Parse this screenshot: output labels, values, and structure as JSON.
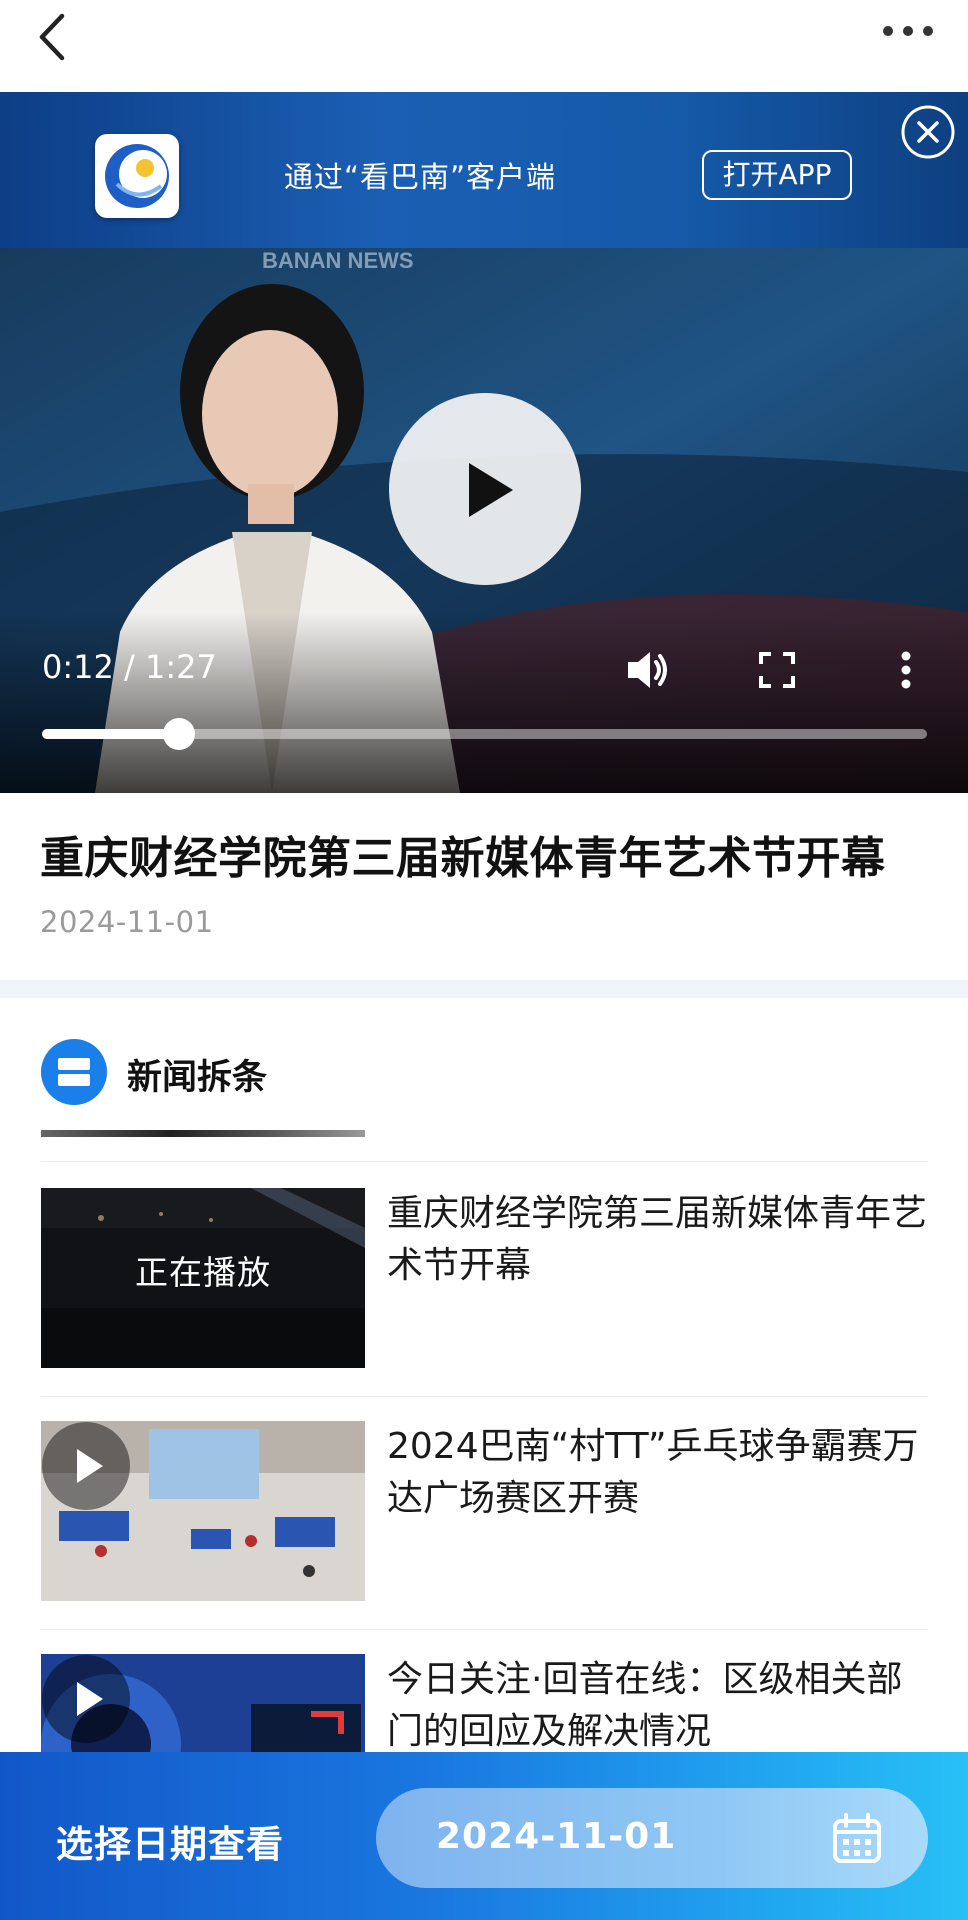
{
  "nav": {
    "back_icon": "chevron-left-icon",
    "more_icon": "more-horizontal-icon"
  },
  "app_banner": {
    "text": "通过“看巴南”客户端",
    "open_label": "打开APP",
    "close_icon": "close-circle-icon",
    "logo_icon": "kanbanan-logo-icon"
  },
  "player": {
    "studio_watermark": "BANAN NEWS",
    "time": "0:12 / 1:27",
    "progress": 0.155,
    "controls": [
      "volume-icon",
      "fullscreen-icon",
      "more-vertical-icon"
    ]
  },
  "article": {
    "title": "重庆财经学院第三届新媒体青年艺术节开幕",
    "date": "2024-11-01"
  },
  "section": {
    "title": "新闻拆条",
    "icon": "news-list-icon"
  },
  "news_items": [
    {
      "title": "重庆财经学院第三届新媒体青年艺术节开幕",
      "status": "正在播放"
    },
    {
      "title": "2024巴南“村TT”乒乓球争霸赛万达广场赛区开赛"
    },
    {
      "title": "今日关注·回音在线：区级相关部门的回应及解决情况"
    }
  ],
  "bottom_bar": {
    "label": "选择日期查看",
    "date": "2024-11-01",
    "calendar_icon": "calendar-icon"
  },
  "colors": {
    "accent_blue": "#1a7fe8",
    "bottom_bar_start": "#1257c9",
    "bottom_bar_end": "#28c0f6",
    "date_gray": "#9a9a9a"
  }
}
